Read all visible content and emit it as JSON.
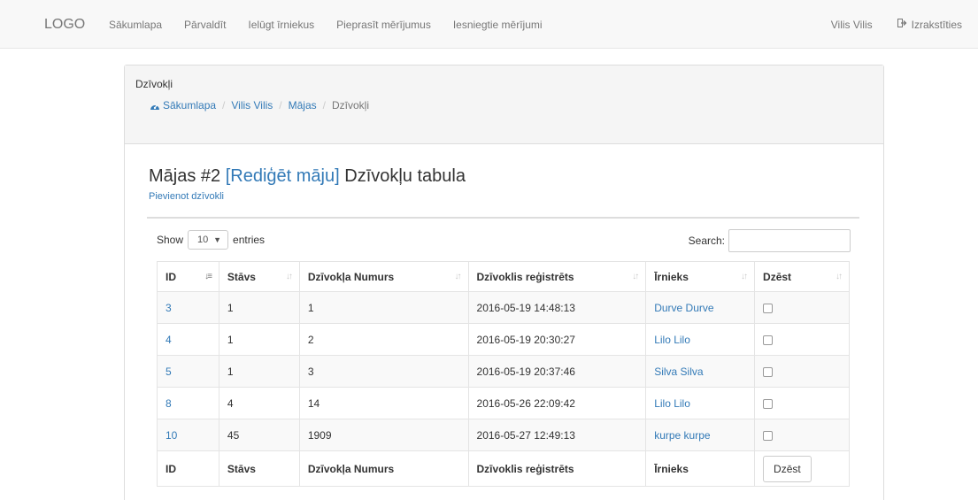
{
  "navbar": {
    "brand": "LOGO",
    "links": [
      "Sākumlapa",
      "Pārvaldīt",
      "Ielūgt īrniekus",
      "Pieprasīt mērījumus",
      "Iesniegtie mērījumi"
    ],
    "user": "Vilis Vilis",
    "logout": "Izrakstīties",
    "logout_icon": "sign-out-icon"
  },
  "panel": {
    "title": "Dzīvokļi",
    "breadcrumb": [
      "Sākumlapa",
      "Vilis Vilis",
      "Mājas",
      "Dzīvokļi"
    ],
    "breadcrumb_icon": "dashboard-icon"
  },
  "heading": {
    "prefix": "Mājas #2 ",
    "edit": "[Rediģēt māju]",
    "suffix": " Dzīvokļu tabula",
    "add_link": "Pievienot dzīvokli"
  },
  "table": {
    "show_label": "Show",
    "entries_value": "10",
    "entries_label": "entries",
    "search_label": "Search:",
    "columns": [
      "ID",
      "Stāvs",
      "Dzīvokļa Numurs",
      "Dzīvoklis reģistrēts",
      "Īrnieks",
      "Dzēst"
    ],
    "rows": [
      {
        "id": "3",
        "floor": "1",
        "number": "1",
        "registered": "2016-05-19 14:48:13",
        "tenant": "Durve Durve"
      },
      {
        "id": "4",
        "floor": "1",
        "number": "2",
        "registered": "2016-05-19 20:30:27",
        "tenant": "Lilo Lilo"
      },
      {
        "id": "5",
        "floor": "1",
        "number": "3",
        "registered": "2016-05-19 20:37:46",
        "tenant": "Silva Silva"
      },
      {
        "id": "8",
        "floor": "4",
        "number": "14",
        "registered": "2016-05-26 22:09:42",
        "tenant": "Lilo Lilo"
      },
      {
        "id": "10",
        "floor": "45",
        "number": "1909",
        "registered": "2016-05-27 12:49:13",
        "tenant": "kurpe kurpe"
      }
    ],
    "footer_columns": [
      "ID",
      "Stāvs",
      "Dzīvokļa Numurs",
      "Dzīvoklis reģistrēts",
      "Īrnieks"
    ],
    "delete_button": "Dzēst"
  }
}
